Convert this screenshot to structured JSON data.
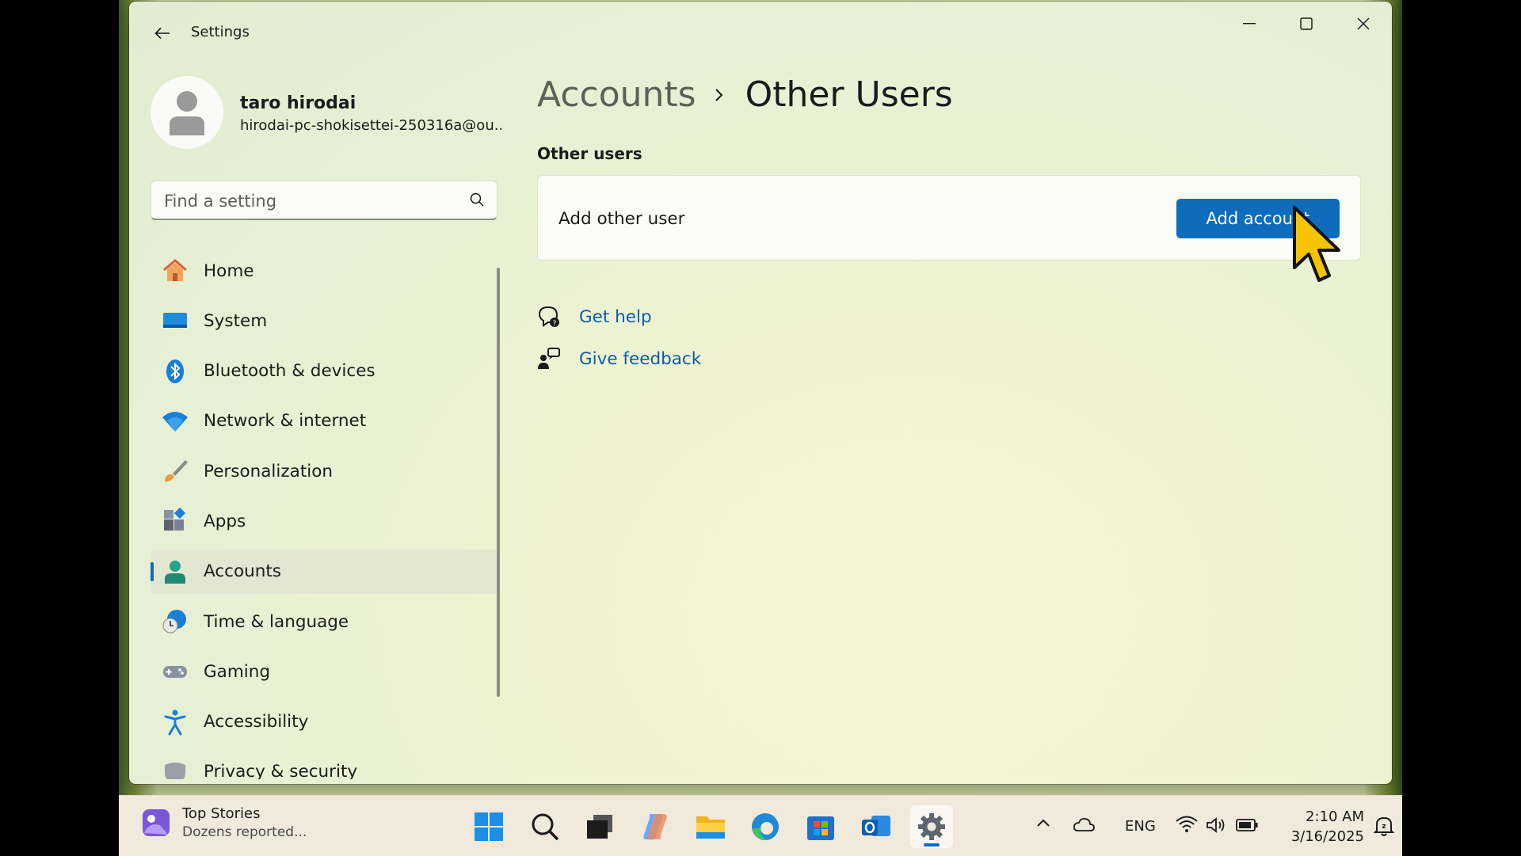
{
  "window": {
    "app_title": "Settings",
    "back_label": "Back",
    "minimize_label": "Minimize",
    "maximize_label": "Maximize",
    "close_label": "Close"
  },
  "user": {
    "name": "taro hirodai",
    "email": "hirodai-pc-shokisettei-250316a@ou..."
  },
  "search": {
    "placeholder": "Find a setting",
    "value": ""
  },
  "nav": {
    "items": [
      {
        "label": "Home",
        "icon": "home-icon"
      },
      {
        "label": "System",
        "icon": "system-icon"
      },
      {
        "label": "Bluetooth & devices",
        "icon": "bluetooth-icon"
      },
      {
        "label": "Network & internet",
        "icon": "network-icon"
      },
      {
        "label": "Personalization",
        "icon": "personalization-brush-icon"
      },
      {
        "label": "Apps",
        "icon": "apps-icon"
      },
      {
        "label": "Accounts",
        "icon": "accounts-icon",
        "selected": true
      },
      {
        "label": "Time & language",
        "icon": "time-language-icon"
      },
      {
        "label": "Gaming",
        "icon": "gaming-icon"
      },
      {
        "label": "Accessibility",
        "icon": "accessibility-icon"
      },
      {
        "label": "Privacy & security",
        "icon": "privacy-shield-icon"
      }
    ]
  },
  "main": {
    "breadcrumb": {
      "parent": "Accounts",
      "current": "Other Users"
    },
    "section_title": "Other users",
    "card": {
      "label": "Add other user",
      "button_label": "Add account"
    },
    "links": [
      {
        "label": "Get help",
        "icon": "get-help-icon"
      },
      {
        "label": "Give feedback",
        "icon": "give-feedback-icon"
      }
    ]
  },
  "taskbar": {
    "widget": {
      "title": "Top Stories",
      "subtitle": "Dozens reported..."
    },
    "apps": [
      {
        "name": "start",
        "icon": "windows-start-icon"
      },
      {
        "name": "search",
        "icon": "search-icon"
      },
      {
        "name": "task-view",
        "icon": "task-view-icon"
      },
      {
        "name": "copilot",
        "icon": "copilot-icon"
      },
      {
        "name": "file-explorer",
        "icon": "file-explorer-icon"
      },
      {
        "name": "edge",
        "icon": "edge-browser-icon"
      },
      {
        "name": "store",
        "icon": "microsoft-store-icon"
      },
      {
        "name": "outlook",
        "icon": "outlook-icon"
      },
      {
        "name": "settings",
        "icon": "settings-gear-icon",
        "active": true
      }
    ],
    "tray": {
      "language": "ENG",
      "time": "2:10 AM",
      "date": "3/16/2025"
    }
  },
  "colors": {
    "accent": "#0f6cbd",
    "link": "#0b5cad",
    "taskbar": "#f0e9dc",
    "window_bg": "#e6f0d4"
  }
}
